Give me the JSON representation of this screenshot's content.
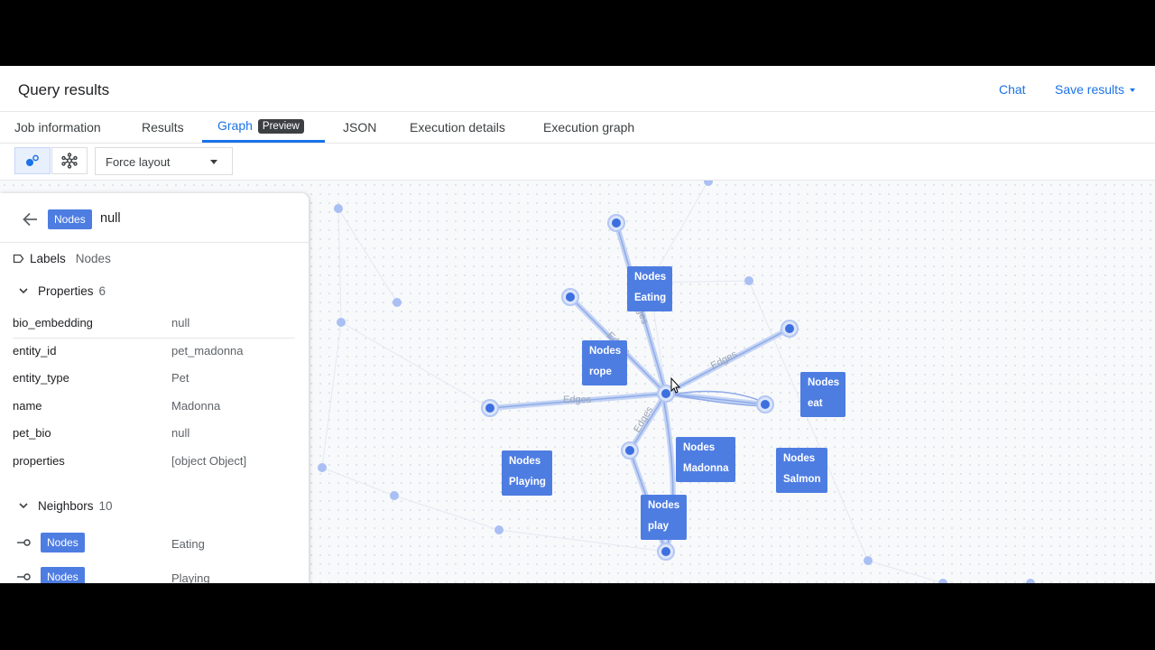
{
  "header": {
    "title": "Query results",
    "chat": "Chat",
    "save_results": "Save results"
  },
  "tabs": [
    {
      "label": "Job information"
    },
    {
      "label": "Results"
    },
    {
      "label": "Graph",
      "badge": "Preview",
      "active": true
    },
    {
      "label": "JSON"
    },
    {
      "label": "Execution details"
    },
    {
      "label": "Execution graph"
    }
  ],
  "toolbar": {
    "layout_value": "Force layout"
  },
  "panel": {
    "chip": "Nodes",
    "title_value": "null",
    "labels_label": "Labels",
    "labels_value": "Nodes",
    "properties_label": "Properties",
    "properties_count": "6",
    "properties": [
      {
        "key": "bio_embedding",
        "value": "null"
      },
      {
        "key": "entity_id",
        "value": "pet_madonna"
      },
      {
        "key": "entity_type",
        "value": "Pet"
      },
      {
        "key": "name",
        "value": "Madonna"
      },
      {
        "key": "pet_bio",
        "value": "null"
      },
      {
        "key": "properties",
        "value": "[object Object]"
      }
    ],
    "neighbors_label": "Neighbors",
    "neighbors_count": "10",
    "neighbors": [
      {
        "chip": "Nodes",
        "value": "Eating"
      },
      {
        "chip": "Nodes",
        "value": "Playing"
      }
    ]
  },
  "graph": {
    "node_label": "Nodes",
    "edge_label": "Edges",
    "nodes": [
      {
        "id": "eating",
        "name": "Eating"
      },
      {
        "id": "rope",
        "name": "rope"
      },
      {
        "id": "eat",
        "name": "eat"
      },
      {
        "id": "madonna",
        "name": "Madonna"
      },
      {
        "id": "playing",
        "name": "Playing"
      },
      {
        "id": "salmon",
        "name": "Salmon"
      },
      {
        "id": "play1",
        "name": "play"
      },
      {
        "id": "play2",
        "name": "play"
      }
    ]
  },
  "colors": {
    "accent": "#1a73e8",
    "node": "#4e7de2",
    "edge": "#b7c9f2",
    "canvas": "#f8f9fb"
  }
}
